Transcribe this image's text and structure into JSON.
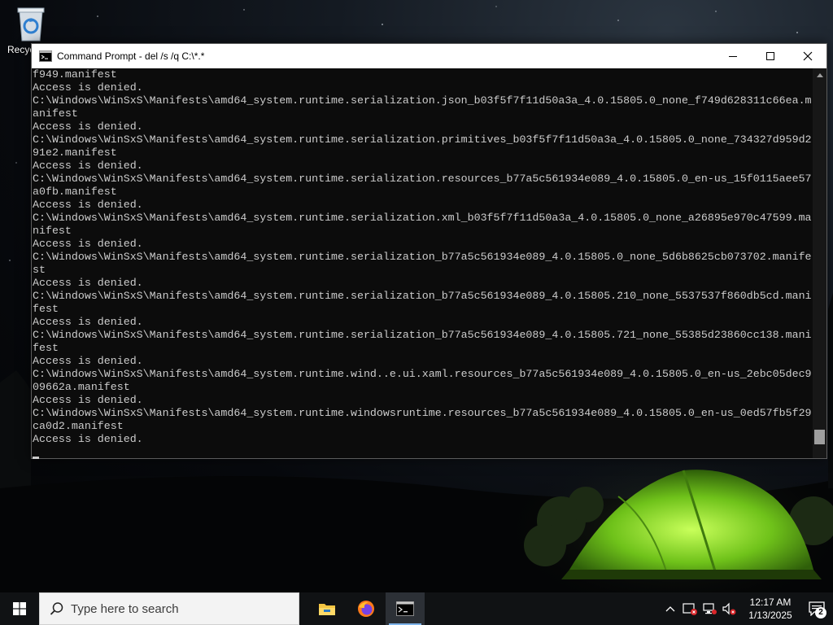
{
  "desktop": {
    "icons": [
      {
        "label": "Recycle Bin",
        "icon": "recycle-bin-icon"
      }
    ]
  },
  "window": {
    "title": "Command Prompt - del  /s /q C:\\*.*",
    "icon": "cmd-icon",
    "controls": {
      "minimize": "minimize-icon",
      "maximize": "maximize-icon",
      "close": "close-icon"
    },
    "console_lines": [
      "f949.manifest",
      "Access is denied.",
      "C:\\Windows\\WinSxS\\Manifests\\amd64_system.runtime.serialization.json_b03f5f7f11d50a3a_4.0.15805.0_none_f749d628311c66ea.m",
      "anifest",
      "Access is denied.",
      "C:\\Windows\\WinSxS\\Manifests\\amd64_system.runtime.serialization.primitives_b03f5f7f11d50a3a_4.0.15805.0_none_734327d959d2",
      "91e2.manifest",
      "Access is denied.",
      "C:\\Windows\\WinSxS\\Manifests\\amd64_system.runtime.serialization.resources_b77a5c561934e089_4.0.15805.0_en-us_15f0115aee57",
      "a0fb.manifest",
      "Access is denied.",
      "C:\\Windows\\WinSxS\\Manifests\\amd64_system.runtime.serialization.xml_b03f5f7f11d50a3a_4.0.15805.0_none_a26895e970c47599.ma",
      "nifest",
      "Access is denied.",
      "C:\\Windows\\WinSxS\\Manifests\\amd64_system.runtime.serialization_b77a5c561934e089_4.0.15805.0_none_5d6b8625cb073702.manife",
      "st",
      "Access is denied.",
      "C:\\Windows\\WinSxS\\Manifests\\amd64_system.runtime.serialization_b77a5c561934e089_4.0.15805.210_none_5537537f860db5cd.mani",
      "fest",
      "Access is denied.",
      "C:\\Windows\\WinSxS\\Manifests\\amd64_system.runtime.serialization_b77a5c561934e089_4.0.15805.721_none_55385d23860cc138.mani",
      "fest",
      "Access is denied.",
      "C:\\Windows\\WinSxS\\Manifests\\amd64_system.runtime.wind..e.ui.xaml.resources_b77a5c561934e089_4.0.15805.0_en-us_2ebc05dec9",
      "09662a.manifest",
      "Access is denied.",
      "C:\\Windows\\WinSxS\\Manifests\\amd64_system.runtime.windowsruntime.resources_b77a5c561934e089_4.0.15805.0_en-us_0ed57fb5f29",
      "ca0d2.manifest",
      "Access is denied."
    ]
  },
  "taskbar": {
    "search_placeholder": "Type here to search",
    "apps": [
      {
        "name": "File Explorer",
        "icon": "file-explorer-icon",
        "active": false
      },
      {
        "name": "Firefox",
        "icon": "firefox-icon",
        "active": false
      },
      {
        "name": "Command Prompt",
        "icon": "cmd-icon",
        "active": true
      }
    ],
    "tray": {
      "icons": [
        "chevron-up-icon",
        "security-alert-icon",
        "network-disconnected-icon",
        "volume-muted-icon"
      ],
      "time": "12:17 AM",
      "date": "1/13/2025",
      "notification_count": "2"
    }
  },
  "colors": {
    "console_bg": "#0c0c0c",
    "console_text": "#cccccc",
    "taskbar_bg": "#101214",
    "tent": "#7cd11e"
  }
}
